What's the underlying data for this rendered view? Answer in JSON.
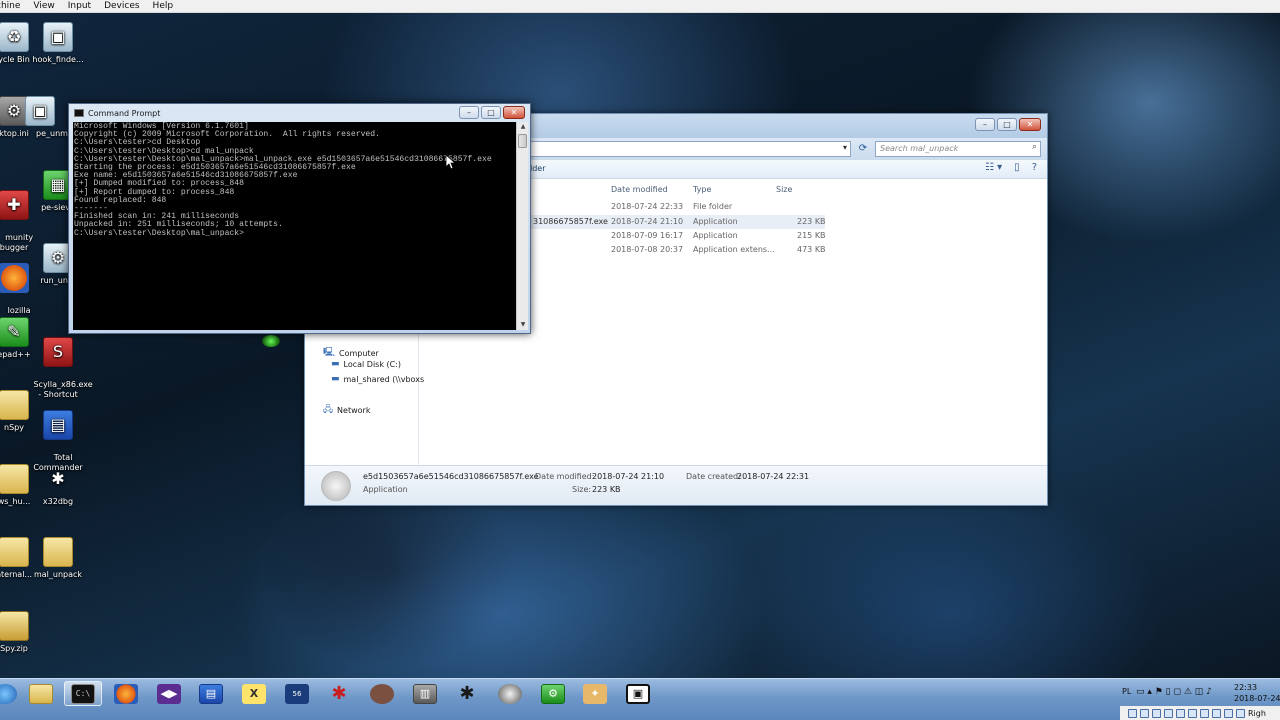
{
  "vm_menu": [
    "chine",
    "View",
    "Input",
    "Devices",
    "Help"
  ],
  "desktop_icons": [
    {
      "label": "ycle Bin",
      "icon": "recycle-bin-icon"
    },
    {
      "label": "hook_finde...",
      "icon": "app-icon"
    },
    {
      "label": "ktop.ini",
      "icon": "file-icon"
    },
    {
      "label": "pe_unm",
      "icon": "app-icon"
    },
    {
      "label": "munity\nbugger",
      "icon": "debugger-icon"
    },
    {
      "label": "pe-sieve",
      "icon": "app-icon"
    },
    {
      "label": "lozilla\nrefox",
      "icon": "firefox-icon"
    },
    {
      "label": "run_unm",
      "icon": "gear-icon"
    },
    {
      "label": "epad++",
      "icon": "notepad-icon"
    },
    {
      "label": "Scylla_x86.exe\n- Shortcut",
      "icon": "scylla-icon"
    },
    {
      "label": "nSpy",
      "icon": "folder-icon"
    },
    {
      "label": "Total\nCommander",
      "icon": "floppy-icon"
    },
    {
      "label": "ws_hu...",
      "icon": "folder-icon"
    },
    {
      "label": "x32dbg",
      "icon": "bug-icon"
    },
    {
      "label": "nternal...",
      "icon": "folder-icon"
    },
    {
      "label": "mal_unpack",
      "icon": "folder-icon"
    },
    {
      "label": "Spy.zip",
      "icon": "zip-icon"
    }
  ],
  "cmd": {
    "title": "Command Prompt",
    "lines": [
      "Microsoft Windows [Version 6.1.7601]",
      "Copyright (c) 2009 Microsoft Corporation.  All rights reserved.",
      "",
      "C:\\Users\\tester>cd Desktop",
      "",
      "C:\\Users\\tester\\Desktop>cd mal_unpack",
      "",
      "C:\\Users\\tester\\Desktop\\mal_unpack>mal_unpack.exe e5d1503657a6e51546cd31086675857f.exe",
      "Starting the process: e5d1503657a6e51546cd31086675857f.exe",
      "Exe name: e5d1503657a6e51546cd31086675857f.exe",
      "[+] Dumped modified to: process_848",
      "[+] Report dumped to: process_848",
      "Found replaced: 848",
      "-------",
      "Finished scan in: 241 milliseconds",
      "Unpacked in: 251 milliseconds; 10 attempts.",
      "",
      "C:\\Users\\tester\\Desktop\\mal_unpack>"
    ]
  },
  "explorer": {
    "search_placeholder": "Search mal_unpack",
    "toolbar_newfolder": "lder",
    "columns": {
      "date": "Date modified",
      "type": "Type",
      "size": "Size"
    },
    "files": [
      {
        "name": "",
        "date": "2018-07-24 22:33",
        "type": "File folder",
        "size": ""
      },
      {
        "name": "31086675857f.exe",
        "date": "2018-07-24 21:10",
        "type": "Application",
        "size": "223 KB",
        "selected": true
      },
      {
        "name": "",
        "date": "2018-07-09 16:17",
        "type": "Application",
        "size": "215 KB"
      },
      {
        "name": "",
        "date": "2018-07-08 20:37",
        "type": "Application extens...",
        "size": "473 KB"
      }
    ],
    "nav": {
      "computer": "Computer",
      "local_disk": "Local Disk (C:)",
      "mal_shared": "mal_shared (\\\\vboxs",
      "network": "Network"
    },
    "details": {
      "filename": "e5d1503657a6e51546cd31086675857f.exe",
      "filetype": "Application",
      "date_modified_label": "Date modified:",
      "date_modified": "2018-07-24 21:10",
      "size_label": "Size:",
      "size": "223 KB",
      "date_created_label": "Date created:",
      "date_created": "2018-07-24 22:31"
    }
  },
  "taskbar": {
    "items": [
      "start-orb-icon",
      "explorer-icon",
      "cmd-icon",
      "firefox-icon",
      "visual-studio-icon",
      "floppy-icon",
      "xvi-icon",
      "hex-editor-icon",
      "debugger-icon",
      "woman-icon",
      "archive-icon",
      "bug-icon",
      "bear-icon",
      "gear-icon",
      "puzzle-icon",
      "window-icon"
    ],
    "lang": "PL",
    "time": "22:33",
    "date": "2018-07-24"
  },
  "vm_status": {
    "host_key": "Righ"
  }
}
